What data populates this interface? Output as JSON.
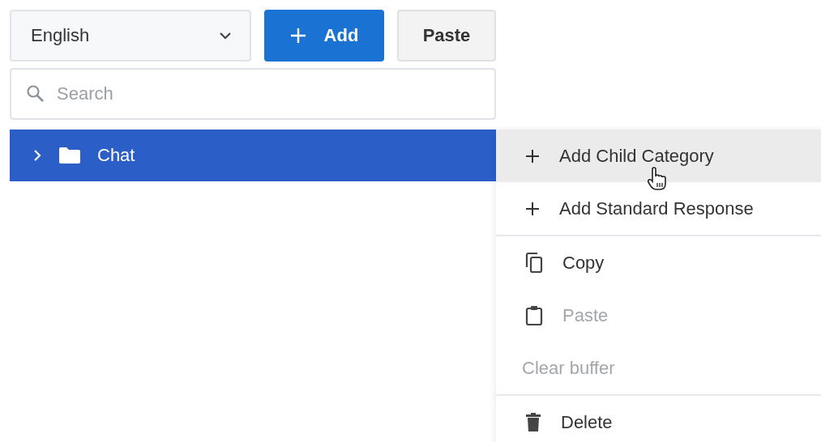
{
  "language_select": {
    "value": "English"
  },
  "add_button": {
    "label": "Add"
  },
  "paste_button": {
    "label": "Paste"
  },
  "search": {
    "placeholder": "Search"
  },
  "tree": [
    {
      "label": "Chat",
      "selected": true,
      "expanded": false
    }
  ],
  "context_menu": {
    "groups": [
      [
        {
          "kind": "plus",
          "label": "Add Child Category",
          "highlighted": true,
          "disabled": false
        },
        {
          "kind": "plus",
          "label": "Add Standard Response",
          "highlighted": false,
          "disabled": false
        }
      ],
      [
        {
          "kind": "copy",
          "label": "Copy",
          "highlighted": false,
          "disabled": false
        },
        {
          "kind": "paste",
          "label": "Paste",
          "highlighted": false,
          "disabled": true
        },
        {
          "kind": "text",
          "label": "Clear buffer",
          "highlighted": false,
          "disabled": true
        }
      ],
      [
        {
          "kind": "delete",
          "label": "Delete",
          "highlighted": false,
          "disabled": false
        }
      ]
    ]
  }
}
